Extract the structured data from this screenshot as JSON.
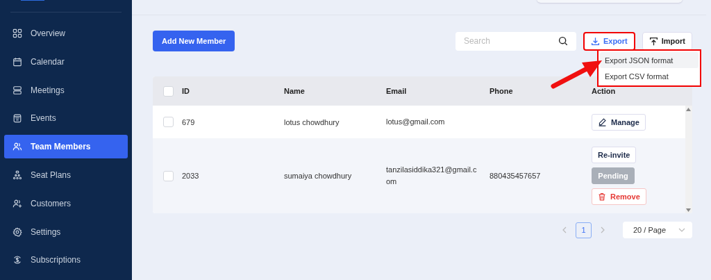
{
  "sidebar": {
    "items": [
      {
        "label": "Overview",
        "selected": false
      },
      {
        "label": "Calendar",
        "selected": false
      },
      {
        "label": "Meetings",
        "selected": false
      },
      {
        "label": "Events",
        "selected": false
      },
      {
        "label": "Team Members",
        "selected": true
      },
      {
        "label": "Seat Plans",
        "selected": false
      },
      {
        "label": "Customers",
        "selected": false
      },
      {
        "label": "Settings",
        "selected": false
      },
      {
        "label": "Subscriptions",
        "selected": false
      }
    ]
  },
  "toolbar": {
    "add_button": "Add New Member",
    "search": {
      "placeholder": "Search"
    },
    "export_button": "Export",
    "import_button": "Import"
  },
  "export_menu": {
    "items": [
      {
        "label": "Export JSON format",
        "selected": true
      },
      {
        "label": "Export CSV format",
        "selected": false
      }
    ]
  },
  "table": {
    "columns": [
      "ID",
      "Name",
      "Email",
      "Phone",
      "Action"
    ],
    "select_all_checked": false,
    "rows": [
      {
        "checked": false,
        "id": "679",
        "name": "lotus chowdhury",
        "email": "lotus@gmail.com",
        "phone": "",
        "actions": [
          {
            "kind": "manage",
            "label": "Manage"
          }
        ]
      },
      {
        "checked": false,
        "id": "2033",
        "name": "sumaiya chowdhury",
        "email": "tanzilasiddika321@gmail.com",
        "phone": "880435457657",
        "actions": [
          {
            "kind": "reinvite",
            "label": "Re-invite"
          },
          {
            "kind": "pending",
            "label": "Pending"
          },
          {
            "kind": "remove",
            "label": "Remove"
          }
        ]
      }
    ]
  },
  "pagination": {
    "pages": [
      {
        "label": "1",
        "selected": true
      }
    ],
    "page_size": "20 / Page"
  }
}
